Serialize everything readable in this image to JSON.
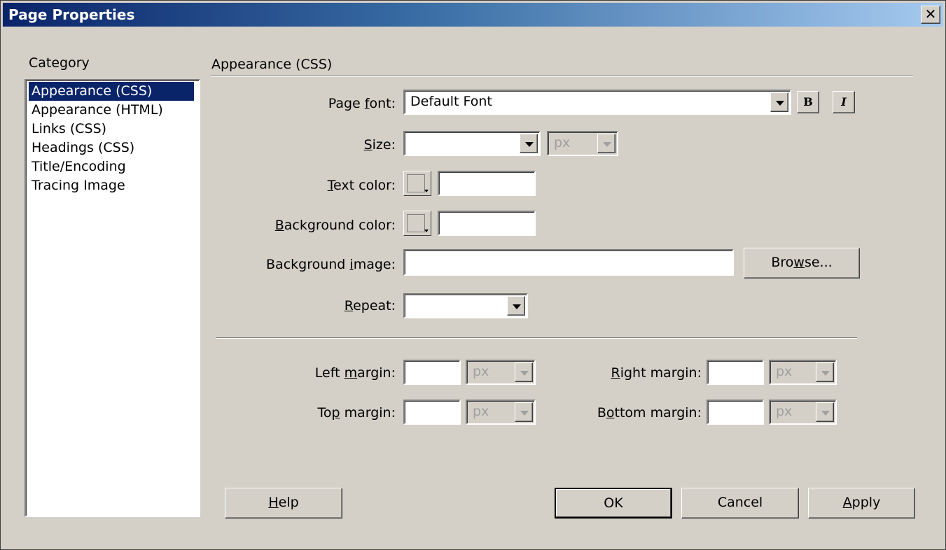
{
  "window": {
    "title": "Page Properties",
    "close_glyph": "✕"
  },
  "sidebar": {
    "heading": "Category",
    "items": [
      {
        "label": "Appearance (CSS)",
        "selected": true
      },
      {
        "label": "Appearance (HTML)",
        "selected": false
      },
      {
        "label": "Links (CSS)",
        "selected": false
      },
      {
        "label": "Headings (CSS)",
        "selected": false
      },
      {
        "label": "Title/Encoding",
        "selected": false
      },
      {
        "label": "Tracing Image",
        "selected": false
      }
    ]
  },
  "main": {
    "section_title": "Appearance (CSS)",
    "page_font": {
      "label_pre": "Page ",
      "label_u": "f",
      "label_post": "ont:",
      "value": "Default Font",
      "bold_label": "B",
      "italic_label": "I"
    },
    "size": {
      "label_pre": "",
      "label_u": "S",
      "label_post": "ize:",
      "value": "",
      "unit": "px"
    },
    "text_color": {
      "label_pre": "",
      "label_u": "T",
      "label_post": "ext color:",
      "value": ""
    },
    "background_color": {
      "label_pre": "",
      "label_u": "B",
      "label_post": "ackground color:",
      "value": ""
    },
    "background_image": {
      "label_pre": "Background ",
      "label_u": "i",
      "label_post": "mage:",
      "value": "",
      "browse_pre": "Bro",
      "browse_u": "w",
      "browse_post": "se..."
    },
    "repeat": {
      "label_pre": "",
      "label_u": "R",
      "label_post": "epeat:",
      "value": ""
    },
    "margins": {
      "left": {
        "label_pre": "Left ",
        "label_u": "m",
        "label_post": "argin:",
        "value": "",
        "unit": "px"
      },
      "right": {
        "label_pre": "",
        "label_u": "R",
        "label_post": "ight margin:",
        "value": "",
        "unit": "px"
      },
      "top": {
        "label_pre": "To",
        "label_u": "p",
        "label_post": " margin:",
        "value": "",
        "unit": "px"
      },
      "bottom": {
        "label_pre": "B",
        "label_u": "o",
        "label_post": "ttom margin:",
        "value": "",
        "unit": "px"
      }
    }
  },
  "footer": {
    "help": {
      "u": "H",
      "rest": "elp"
    },
    "ok": "OK",
    "cancel": "Cancel",
    "apply": {
      "u": "A",
      "rest": "pply"
    }
  },
  "colors": {
    "dialog_bg": "#d4d0c8",
    "title_gradient_start": "#0a246a",
    "title_gradient_end": "#a6caf0",
    "selection": "#0a246a"
  }
}
